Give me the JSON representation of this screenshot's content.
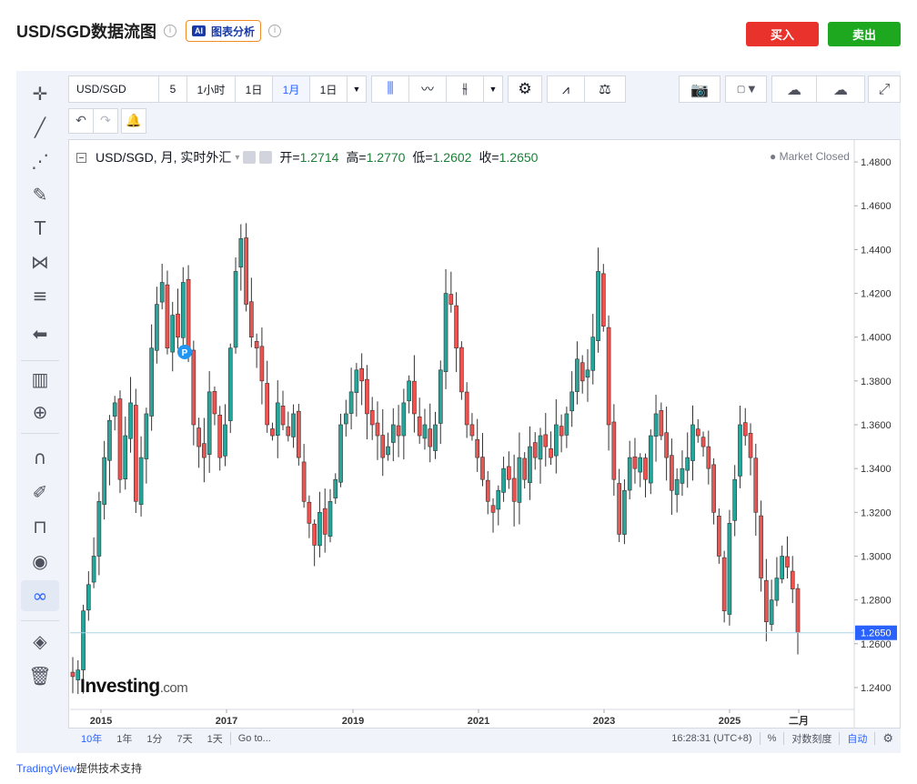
{
  "header": {
    "title": "USD/SGD数据流图",
    "ai_badge": "AI",
    "ai_label": "图表分析",
    "info_glyph": "i",
    "buy_label": "买入",
    "sell_label": "卖出"
  },
  "toolbar": {
    "symbol": "USD/SGD",
    "intervals": [
      "5",
      "1小时",
      "1日",
      "1月",
      "1日"
    ],
    "active_interval": "1月",
    "icons": [
      "candles-icon",
      "area-chart-icon",
      "bar-chart-icon",
      "settings-icon",
      "indicators-icon",
      "compare-icon",
      "camera-icon",
      "color-box-icon",
      "cloud-download-icon",
      "cloud-upload-icon",
      "fullscreen-icon"
    ]
  },
  "legend": {
    "title": "USD/SGD, 月, 实时外汇",
    "open_label": "开=",
    "open": "1.2714",
    "high_label": "高=",
    "high": "1.2770",
    "low_label": "低=",
    "low": "1.2602",
    "close_label": "收=",
    "close": "1.2650",
    "status": "● Market Closed"
  },
  "bottom_bar": {
    "ranges": [
      "10年",
      "1年",
      "1分",
      "7天",
      "1天"
    ],
    "goto": "Go to...",
    "time": "16:28:31 (UTC+8)",
    "percent": "%",
    "log": "对数刻度",
    "auto": "自动"
  },
  "credit": {
    "brand": "TradingView",
    "text": "提供技术支持"
  },
  "logo": {
    "brand": "Investing",
    "suffix": ".com"
  },
  "colors": {
    "up": "#26a69a",
    "down": "#ef5350",
    "price_line": "#a9d6e5",
    "price_tag": "#2962ff",
    "buy": "#e8322b",
    "sell": "#1da820"
  },
  "chart_data": {
    "type": "candlestick",
    "symbol": "USD/SGD",
    "interval": "月",
    "ylim": [
      1.23,
      1.49
    ],
    "y_ticks": [
      "1.4800",
      "1.4600",
      "1.4400",
      "1.4200",
      "1.4000",
      "1.3800",
      "1.3600",
      "1.3400",
      "1.3200",
      "1.3000",
      "1.2800",
      "1.2600",
      "1.2400"
    ],
    "x_ticks": [
      "2015",
      "2017",
      "2019",
      "2021",
      "2023",
      "2025",
      "二月"
    ],
    "last_price": "1.2650",
    "marker": "P",
    "close_series": [
      1.245,
      1.248,
      1.275,
      1.287,
      1.3,
      1.325,
      1.345,
      1.362,
      1.37,
      1.335,
      1.355,
      1.37,
      1.325,
      1.345,
      1.365,
      1.395,
      1.415,
      1.425,
      1.395,
      1.41,
      1.4,
      1.425,
      1.395,
      1.36,
      1.35,
      1.345,
      1.375,
      1.365,
      1.345,
      1.36,
      1.395,
      1.43,
      1.445,
      1.415,
      1.4,
      1.395,
      1.38,
      1.36,
      1.355,
      1.37,
      1.36,
      1.355,
      1.365,
      1.345,
      1.325,
      1.315,
      1.305,
      1.32,
      1.31,
      1.325,
      1.335,
      1.36,
      1.365,
      1.375,
      1.385,
      1.38,
      1.365,
      1.36,
      1.355,
      1.345,
      1.35,
      1.36,
      1.355,
      1.37,
      1.38,
      1.365,
      1.355,
      1.36,
      1.35,
      1.36,
      1.385,
      1.42,
      1.415,
      1.395,
      1.375,
      1.36,
      1.355,
      1.345,
      1.335,
      1.325,
      1.32,
      1.33,
      1.34,
      1.335,
      1.325,
      1.345,
      1.335,
      1.35,
      1.345,
      1.355,
      1.35,
      1.345,
      1.36,
      1.355,
      1.365,
      1.375,
      1.39,
      1.38,
      1.385,
      1.4,
      1.43,
      1.405,
      1.36,
      1.335,
      1.31,
      1.33,
      1.345,
      1.34,
      1.345,
      1.335,
      1.355,
      1.365,
      1.355,
      1.345,
      1.33,
      1.335,
      1.34,
      1.345,
      1.36,
      1.355,
      1.35,
      1.34,
      1.32,
      1.3,
      1.275,
      1.315,
      1.335,
      1.36,
      1.355,
      1.345,
      1.32,
      1.29,
      1.27,
      1.28,
      1.29,
      1.3,
      1.295,
      1.285,
      1.265
    ]
  }
}
